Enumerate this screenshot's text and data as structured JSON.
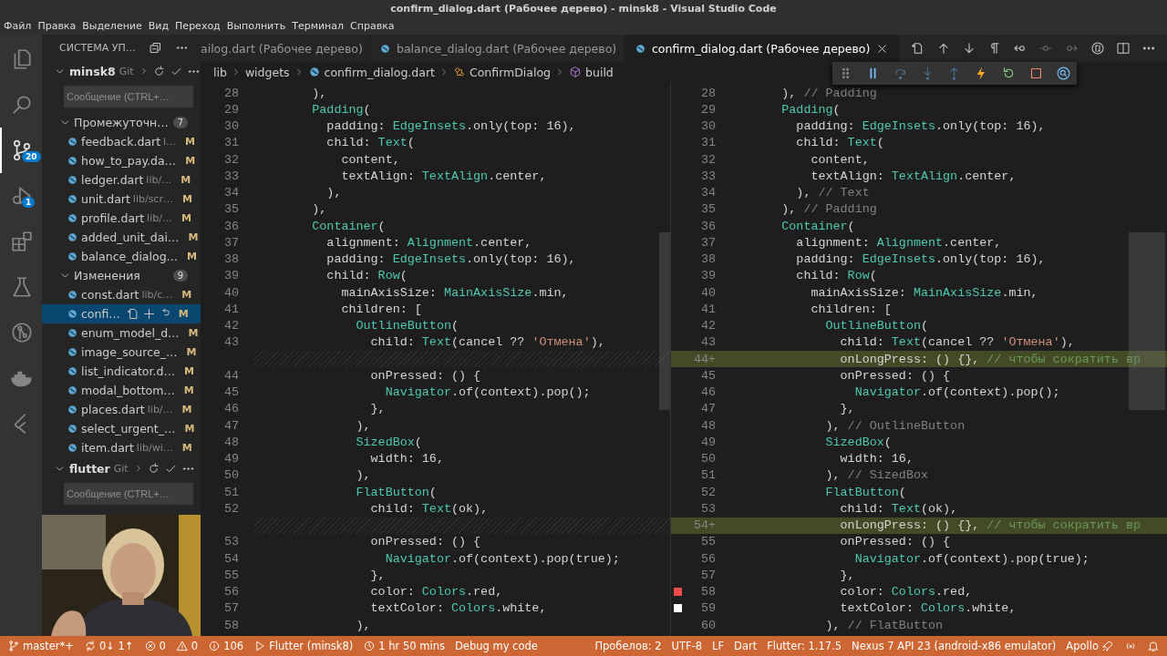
{
  "window": {
    "title": "confirm_dialog.dart (Рабочее дерево) - minsk8 - Visual Studio Code"
  },
  "menu": [
    "Файл",
    "Правка",
    "Выделение",
    "Вид",
    "Переход",
    "Выполнить",
    "Терминал",
    "Справка"
  ],
  "activity_bar": [
    {
      "selected": false
    },
    {
      "selected": false
    },
    {
      "selected": true,
      "badge": "20"
    },
    {
      "selected": false,
      "badge": "1"
    },
    {
      "selected": false
    },
    {
      "selected": false
    },
    {
      "selected": false
    },
    {
      "selected": false
    },
    {
      "selected": false
    }
  ],
  "sidebar": {
    "title": "СИСТЕМА УП…",
    "repositories": [
      {
        "name": "minsk8",
        "provider": "Git",
        "expanded": true,
        "message_placeholder": "Сообщение (CTRL+…",
        "groups": [
          {
            "label": "Промежуточн…",
            "count": "7",
            "expanded": true,
            "files": [
              {
                "name": "feedback.dart",
                "path": "l…",
                "status": "M",
                "selected": false
              },
              {
                "name": "how_to_pay.da…",
                "status": "M",
                "selected": false
              },
              {
                "name": "ledger.dart",
                "path": "lib/…",
                "status": "M",
                "selected": false
              },
              {
                "name": "unit.dart",
                "path": "lib/scr…",
                "status": "M",
                "selected": false
              },
              {
                "name": "profile.dart",
                "path": "lib/…",
                "status": "M",
                "selected": false
              },
              {
                "name": "added_unit_dai…",
                "status": "M",
                "selected": false
              },
              {
                "name": "balance_dialog…",
                "status": "M",
                "selected": false
              }
            ]
          },
          {
            "label": "Изменения",
            "count": "9",
            "expanded": true,
            "files": [
              {
                "name": "const.dart",
                "path": "lib/c…",
                "status": "M",
                "selected": false
              },
              {
                "name": "confi…",
                "status": "M",
                "selected": true
              },
              {
                "name": "enum_model_d…",
                "status": "M",
                "selected": false
              },
              {
                "name": "image_source_…",
                "status": "M",
                "selected": false
              },
              {
                "name": "list_indicator.d…",
                "status": "M",
                "selected": false
              },
              {
                "name": "modal_bottom…",
                "status": "M",
                "selected": false
              },
              {
                "name": "places.dart",
                "path": "lib/…",
                "status": "M",
                "selected": false
              },
              {
                "name": "select_urgent_…",
                "status": "M",
                "selected": false
              },
              {
                "name": "item.dart",
                "path": "lib/wi…",
                "status": "M",
                "selected": false
              }
            ]
          }
        ]
      },
      {
        "name": "flutter",
        "provider": "Git",
        "expanded": true,
        "message_placeholder": "Сообщение (CTRL+…"
      }
    ]
  },
  "tabs": [
    {
      "label": "ailog.dart (Рабочее дерево)",
      "file_icon": false,
      "selected": false
    },
    {
      "label": "balance_dialog.dart (Рабочее дерево)",
      "file_icon": true,
      "selected": false
    },
    {
      "label": "confirm_dialog.dart (Рабочее дерево)",
      "file_icon": true,
      "selected": true
    }
  ],
  "breadcrumbs": [
    {
      "label": "lib",
      "kind": "folder"
    },
    {
      "label": "widgets",
      "kind": "folder"
    },
    {
      "label": "confirm_dialog.dart",
      "kind": "file"
    },
    {
      "label": "ConfirmDialog",
      "kind": "class"
    },
    {
      "label": "build",
      "kind": "method"
    }
  ],
  "editors": [
    {
      "lines": [
        {
          "number": "28",
          "segments": [
            {
              "text": "        ),"
            }
          ]
        },
        {
          "number": "29",
          "segments": [
            {
              "text": "        Padding",
              "kind": "type"
            },
            {
              "text": "("
            }
          ]
        },
        {
          "number": "30",
          "segments": [
            {
              "text": "          padding: "
            },
            {
              "text": "EdgeInsets",
              "kind": "type"
            },
            {
              "text": ".only(top: 16),"
            }
          ]
        },
        {
          "number": "31",
          "segments": [
            {
              "text": "          child: "
            },
            {
              "text": "Text",
              "kind": "type"
            },
            {
              "text": "("
            }
          ]
        },
        {
          "number": "32",
          "segments": [
            {
              "text": "            content,"
            }
          ]
        },
        {
          "number": "33",
          "segments": [
            {
              "text": "            textAlign: "
            },
            {
              "text": "TextAlign",
              "kind": "type"
            },
            {
              "text": ".center,"
            }
          ]
        },
        {
          "number": "34",
          "segments": [
            {
              "text": "          ),"
            }
          ]
        },
        {
          "number": "35",
          "segments": [
            {
              "text": "        ),"
            }
          ]
        },
        {
          "number": "36",
          "segments": [
            {
              "text": "        Container",
              "kind": "type"
            },
            {
              "text": "("
            }
          ]
        },
        {
          "number": "37",
          "segments": [
            {
              "text": "          alignment: "
            },
            {
              "text": "Alignment",
              "kind": "type"
            },
            {
              "text": ".center,"
            }
          ]
        },
        {
          "number": "38",
          "segments": [
            {
              "text": "          padding: "
            },
            {
              "text": "EdgeInsets",
              "kind": "type"
            },
            {
              "text": ".only(top: 16),"
            }
          ]
        },
        {
          "number": "39",
          "segments": [
            {
              "text": "          child: "
            },
            {
              "text": "Row",
              "kind": "type"
            },
            {
              "text": "("
            }
          ]
        },
        {
          "number": "40",
          "segments": [
            {
              "text": "            mainAxisSize: "
            },
            {
              "text": "MainAxisSize",
              "kind": "type"
            },
            {
              "text": ".min,"
            }
          ]
        },
        {
          "number": "41",
          "segments": [
            {
              "text": "            children: ["
            }
          ]
        },
        {
          "number": "42",
          "segments": [
            {
              "text": "              OutlineButton",
              "kind": "type"
            },
            {
              "text": "("
            }
          ]
        },
        {
          "number": "43",
          "segments": [
            {
              "text": "                child: "
            },
            {
              "text": "Text",
              "kind": "type"
            },
            {
              "text": "(cancel ?? "
            },
            {
              "text": "'Отмена'",
              "kind": "string"
            },
            {
              "text": "),"
            }
          ]
        },
        {
          "kind": "gap"
        },
        {
          "number": "44",
          "segments": [
            {
              "text": "                onPressed: () {"
            }
          ]
        },
        {
          "number": "45",
          "segments": [
            {
              "text": "                  Navigator",
              "kind": "type"
            },
            {
              "text": ".of(context).pop();"
            }
          ]
        },
        {
          "number": "46",
          "segments": [
            {
              "text": "                },"
            }
          ]
        },
        {
          "number": "47",
          "segments": [
            {
              "text": "              ),"
            }
          ]
        },
        {
          "number": "48",
          "segments": [
            {
              "text": "              SizedBox",
              "kind": "type"
            },
            {
              "text": "("
            }
          ]
        },
        {
          "number": "49",
          "segments": [
            {
              "text": "                width: 16,"
            }
          ]
        },
        {
          "number": "50",
          "segments": [
            {
              "text": "              ),"
            }
          ]
        },
        {
          "number": "51",
          "segments": [
            {
              "text": "              FlatButton",
              "kind": "type"
            },
            {
              "text": "("
            }
          ]
        },
        {
          "number": "52",
          "segments": [
            {
              "text": "                child: "
            },
            {
              "text": "Text",
              "kind": "type"
            },
            {
              "text": "(ok),"
            }
          ]
        },
        {
          "kind": "gap"
        },
        {
          "number": "53",
          "segments": [
            {
              "text": "                onPressed: () {"
            }
          ]
        },
        {
          "number": "54",
          "segments": [
            {
              "text": "                  Navigator",
              "kind": "type"
            },
            {
              "text": ".of(context).pop(true);"
            }
          ]
        },
        {
          "number": "55",
          "segments": [
            {
              "text": "                },"
            }
          ]
        },
        {
          "number": "56",
          "segments": [
            {
              "text": "                color: "
            },
            {
              "text": "Colors",
              "kind": "type"
            },
            {
              "text": ".red,"
            }
          ]
        },
        {
          "number": "57",
          "segments": [
            {
              "text": "                textColor: "
            },
            {
              "text": "Colors",
              "kind": "type"
            },
            {
              "text": ".white,"
            }
          ]
        },
        {
          "number": "58",
          "segments": [
            {
              "text": "              ),"
            }
          ]
        }
      ]
    },
    {
      "lines": [
        {
          "number": "28",
          "added": false,
          "segments": [
            {
              "text": "        ), "
            },
            {
              "text": "// Padding",
              "kind": "label"
            }
          ]
        },
        {
          "number": "29",
          "added": false,
          "segments": [
            {
              "text": "        Padding",
              "kind": "type"
            },
            {
              "text": "("
            }
          ]
        },
        {
          "number": "30",
          "added": false,
          "segments": [
            {
              "text": "          padding: "
            },
            {
              "text": "EdgeInsets",
              "kind": "type"
            },
            {
              "text": ".only(top: 16),"
            }
          ]
        },
        {
          "number": "31",
          "added": false,
          "segments": [
            {
              "text": "          child: "
            },
            {
              "text": "Text",
              "kind": "type"
            },
            {
              "text": "("
            }
          ]
        },
        {
          "number": "32",
          "added": false,
          "segments": [
            {
              "text": "            content,"
            }
          ]
        },
        {
          "number": "33",
          "added": false,
          "segments": [
            {
              "text": "            textAlign: "
            },
            {
              "text": "TextAlign",
              "kind": "type"
            },
            {
              "text": ".center,"
            }
          ]
        },
        {
          "number": "34",
          "added": false,
          "segments": [
            {
              "text": "          ), "
            },
            {
              "text": "// Text",
              "kind": "label"
            }
          ]
        },
        {
          "number": "35",
          "added": false,
          "segments": [
            {
              "text": "        ), "
            },
            {
              "text": "// Padding",
              "kind": "label"
            }
          ]
        },
        {
          "number": "36",
          "added": false,
          "segments": [
            {
              "text": "        Container",
              "kind": "type"
            },
            {
              "text": "("
            }
          ]
        },
        {
          "number": "37",
          "added": false,
          "segments": [
            {
              "text": "          alignment: "
            },
            {
              "text": "Alignment",
              "kind": "type"
            },
            {
              "text": ".center,"
            }
          ]
        },
        {
          "number": "38",
          "added": false,
          "segments": [
            {
              "text": "          padding: "
            },
            {
              "text": "EdgeInsets",
              "kind": "type"
            },
            {
              "text": ".only(top: 16),"
            }
          ]
        },
        {
          "number": "39",
          "added": false,
          "segments": [
            {
              "text": "          child: "
            },
            {
              "text": "Row",
              "kind": "type"
            },
            {
              "text": "("
            }
          ]
        },
        {
          "number": "40",
          "added": false,
          "segments": [
            {
              "text": "            mainAxisSize: "
            },
            {
              "text": "MainAxisSize",
              "kind": "type"
            },
            {
              "text": ".min,"
            }
          ]
        },
        {
          "number": "41",
          "added": false,
          "segments": [
            {
              "text": "            children: ["
            }
          ]
        },
        {
          "number": "42",
          "added": false,
          "segments": [
            {
              "text": "              OutlineButton",
              "kind": "type"
            },
            {
              "text": "("
            }
          ]
        },
        {
          "number": "43",
          "added": false,
          "segments": [
            {
              "text": "                child: "
            },
            {
              "text": "Text",
              "kind": "type"
            },
            {
              "text": "(cancel ?? "
            },
            {
              "text": "'Отмена'",
              "kind": "string"
            },
            {
              "text": "),"
            }
          ]
        },
        {
          "number": "44+",
          "added": true,
          "segments": [
            {
              "text": "                onLongPress: () {}, "
            },
            {
              "text": "// чтобы сократить вр",
              "kind": "comment"
            }
          ]
        },
        {
          "number": "45",
          "added": false,
          "segments": [
            {
              "text": "                onPressed: () {"
            }
          ]
        },
        {
          "number": "46",
          "added": false,
          "segments": [
            {
              "text": "                  Navigator",
              "kind": "type"
            },
            {
              "text": ".of(context).pop();"
            }
          ]
        },
        {
          "number": "47",
          "added": false,
          "segments": [
            {
              "text": "                },"
            }
          ]
        },
        {
          "number": "48",
          "added": false,
          "segments": [
            {
              "text": "              ), "
            },
            {
              "text": "// OutlineButton",
              "kind": "label"
            }
          ]
        },
        {
          "number": "49",
          "added": false,
          "segments": [
            {
              "text": "              SizedBox",
              "kind": "type"
            },
            {
              "text": "("
            }
          ]
        },
        {
          "number": "50",
          "added": false,
          "segments": [
            {
              "text": "                width: 16,"
            }
          ]
        },
        {
          "number": "51",
          "added": false,
          "segments": [
            {
              "text": "              ), "
            },
            {
              "text": "// SizedBox",
              "kind": "label"
            }
          ]
        },
        {
          "number": "52",
          "added": false,
          "segments": [
            {
              "text": "              FlatButton",
              "kind": "type"
            },
            {
              "text": "("
            }
          ]
        },
        {
          "number": "53",
          "added": false,
          "segments": [
            {
              "text": "                child: "
            },
            {
              "text": "Text",
              "kind": "type"
            },
            {
              "text": "(ok),"
            }
          ]
        },
        {
          "number": "54+",
          "added": true,
          "segments": [
            {
              "text": "                onLongPress: () {}, "
            },
            {
              "text": "// чтобы сократить вр",
              "kind": "comment"
            }
          ]
        },
        {
          "number": "55",
          "added": false,
          "segments": [
            {
              "text": "                onPressed: () {"
            }
          ]
        },
        {
          "number": "56",
          "added": false,
          "segments": [
            {
              "text": "                  Navigator",
              "kind": "type"
            },
            {
              "text": ".of(context).pop(true);"
            }
          ]
        },
        {
          "number": "57",
          "added": false,
          "segments": [
            {
              "text": "                },"
            }
          ]
        },
        {
          "number": "58",
          "added": false,
          "color": "#f14c4c",
          "segments": [
            {
              "text": "                color: "
            },
            {
              "text": "Colors",
              "kind": "type"
            },
            {
              "text": ".red,"
            }
          ]
        },
        {
          "number": "59",
          "added": false,
          "color": "#ffffff",
          "segments": [
            {
              "text": "                textColor: "
            },
            {
              "text": "Colors",
              "kind": "type"
            },
            {
              "text": ".white,"
            }
          ]
        },
        {
          "number": "60",
          "added": false,
          "segments": [
            {
              "text": "              ), "
            },
            {
              "text": "// FlatButton",
              "kind": "label"
            }
          ]
        }
      ]
    }
  ],
  "status_bar": {
    "left": [
      {
        "kind": "branch",
        "text": "master*+"
      },
      {
        "kind": "sync",
        "text": "0↓ 1↑"
      },
      {
        "kind": "error",
        "text": "0"
      },
      {
        "kind": "warning",
        "text": "0"
      },
      {
        "kind": "info",
        "text": "106"
      },
      {
        "kind": "play",
        "text": "Flutter (minsk8)"
      },
      {
        "kind": "clock",
        "text": "1 hr 50 mins"
      },
      {
        "kind": "plain",
        "text": "Debug my code"
      }
    ],
    "right": [
      {
        "kind": "plain",
        "text": "Пробелов: 2"
      },
      {
        "kind": "plain",
        "text": "UTF-8"
      },
      {
        "kind": "plain",
        "text": "LF"
      },
      {
        "kind": "plain",
        "text": "Dart"
      },
      {
        "kind": "plain",
        "text": "Flutter: 1.17.5"
      },
      {
        "kind": "plain",
        "text": "Nexus 7 API 23 (android-x86 emulator)"
      },
      {
        "kind": "rocket",
        "text": "Apollo"
      },
      {
        "kind": "broadcast"
      },
      {
        "kind": "bell"
      }
    ]
  },
  "webcam": {
    "kind": "picture"
  }
}
